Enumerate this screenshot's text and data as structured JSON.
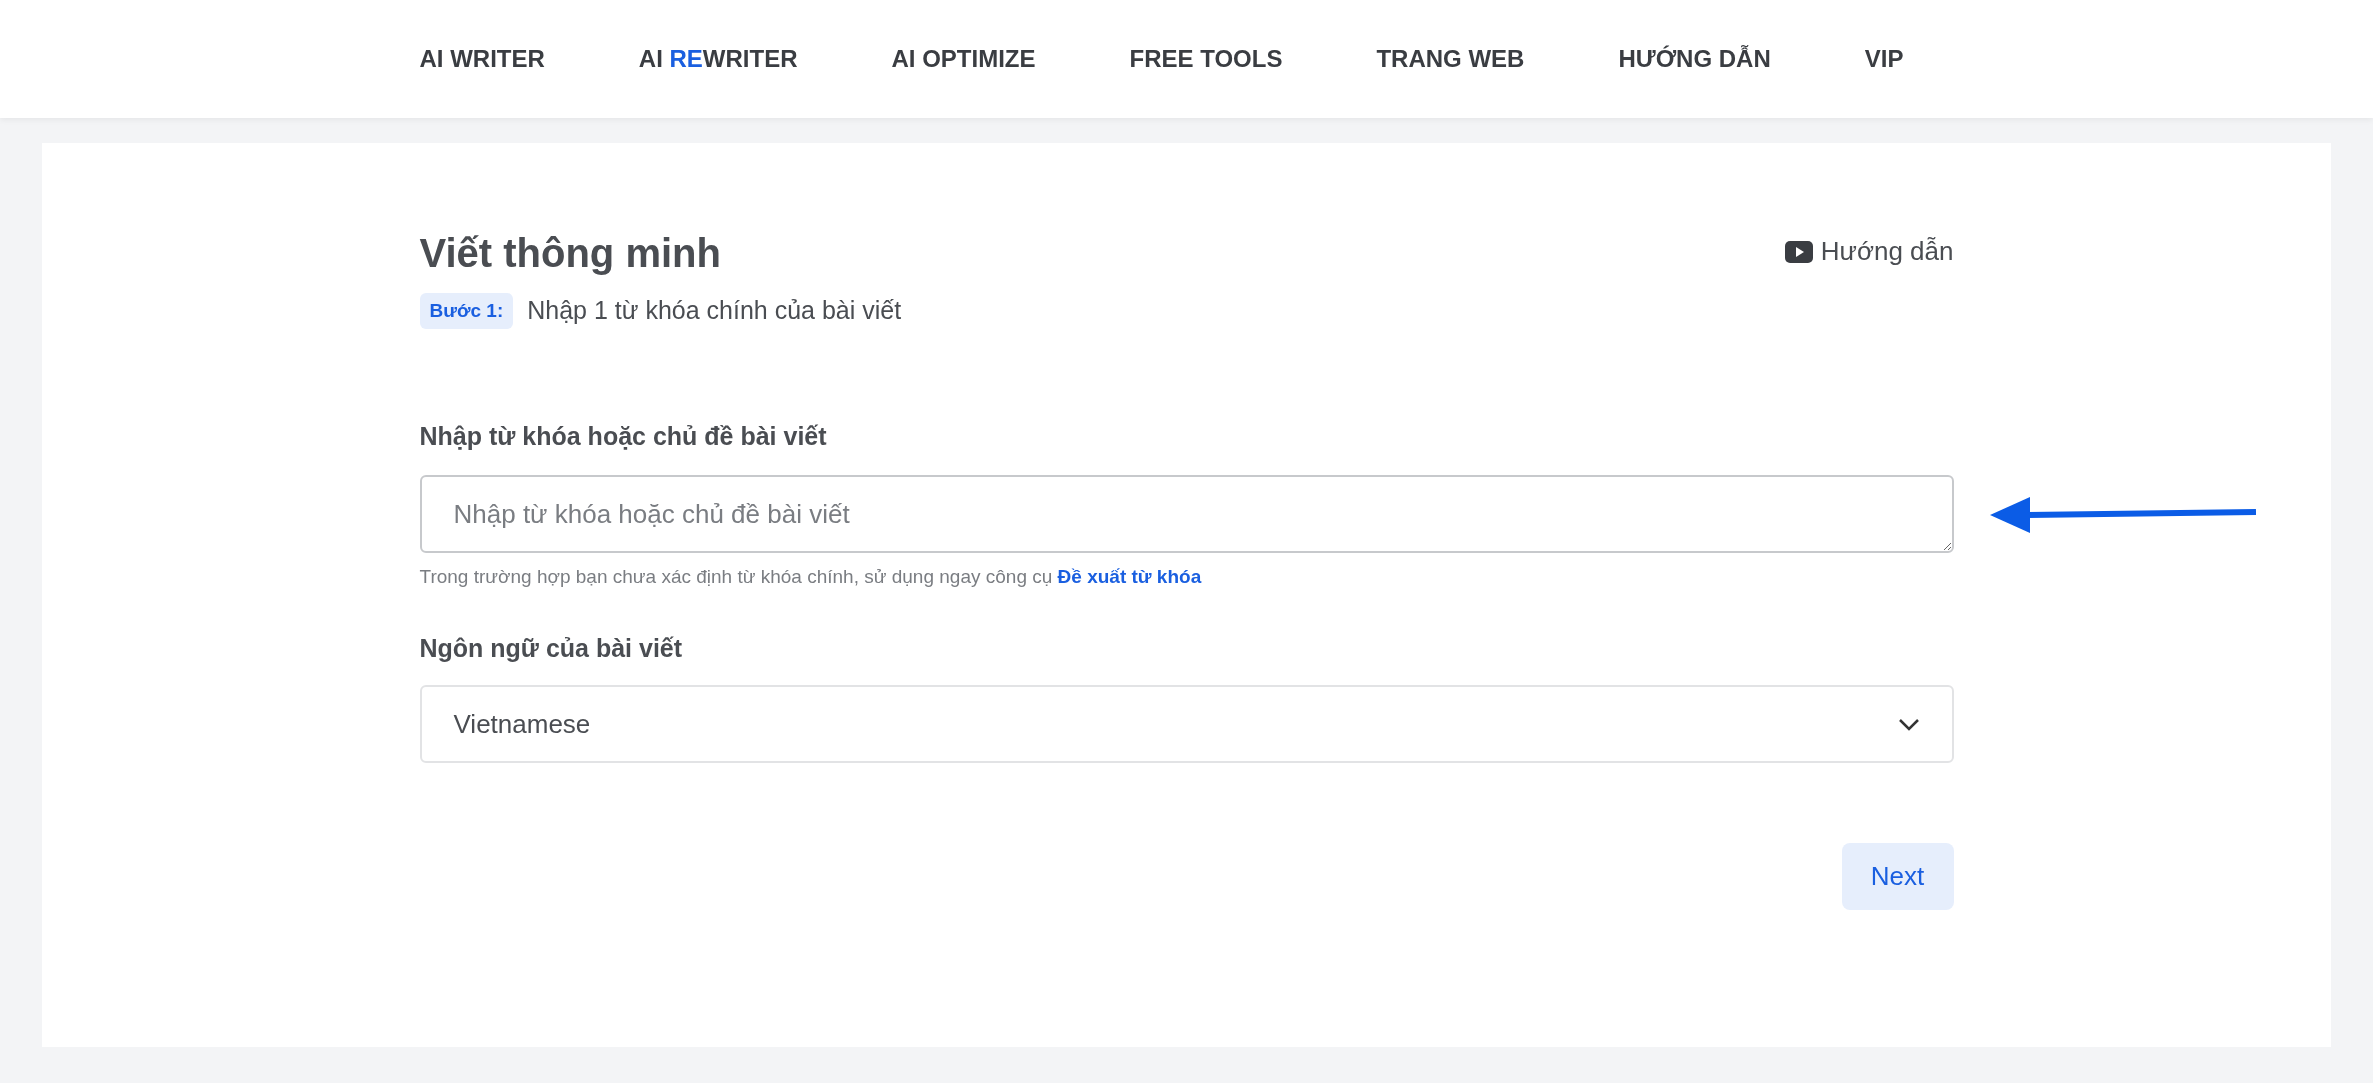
{
  "nav": [
    {
      "parts": [
        {
          "text": "AI WRITER",
          "highlight": false
        }
      ]
    },
    {
      "parts": [
        {
          "text": "AI ",
          "highlight": false
        },
        {
          "text": "RE",
          "highlight": true
        },
        {
          "text": "WRITER",
          "highlight": false
        }
      ]
    },
    {
      "parts": [
        {
          "text": "AI OPTIMIZE",
          "highlight": false
        }
      ]
    },
    {
      "parts": [
        {
          "text": "FREE TOOLS",
          "highlight": false
        }
      ]
    },
    {
      "parts": [
        {
          "text": "TRANG WEB",
          "highlight": false
        }
      ]
    },
    {
      "parts": [
        {
          "text": "HƯỚNG DẪN",
          "highlight": false
        }
      ]
    },
    {
      "parts": [
        {
          "text": "VIP",
          "highlight": false
        }
      ]
    }
  ],
  "page": {
    "title": "Viết thông minh",
    "guide_link": "Hướng dẫn",
    "step_badge": "Bước 1:",
    "step_text": "Nhập 1 từ khóa chính của bài viết"
  },
  "keyword": {
    "label": "Nhập từ khóa hoặc chủ đề bài viết",
    "placeholder": "Nhập từ khóa hoặc chủ đề bài viết",
    "hint": "Trong trường hợp bạn chưa xác định từ khóa chính, sử dụng ngay công cụ",
    "hint_link": "Đề xuất từ khóa"
  },
  "language": {
    "label": "Ngôn ngữ của bài viết",
    "value": "Vietnamese"
  },
  "next_button": "Next"
}
